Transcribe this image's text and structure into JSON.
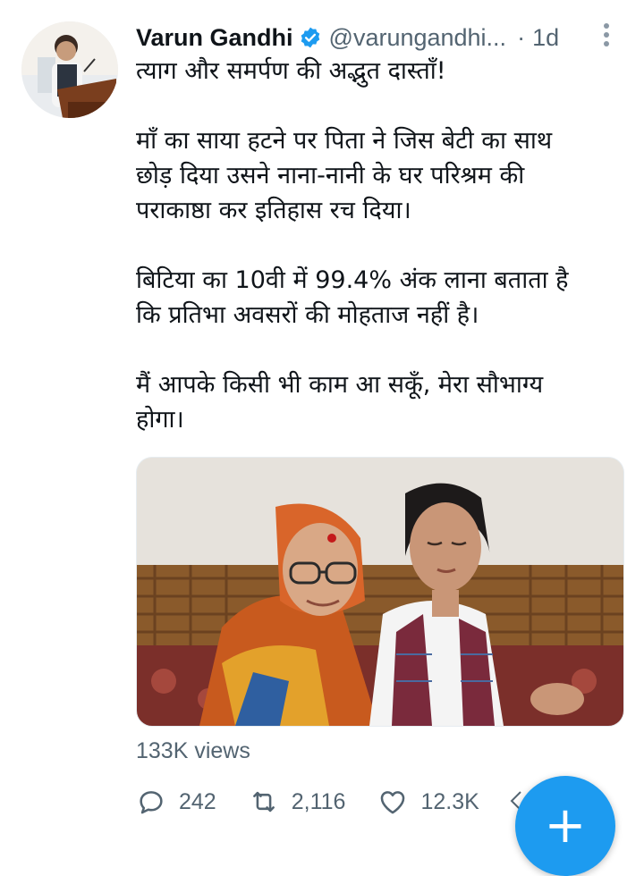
{
  "tweet": {
    "author": {
      "display_name": "Varun Gandhi",
      "handle": "@varungandhi...",
      "verified": true,
      "avatar_icon": "profile-photo-speaker-at-podium"
    },
    "separator": "·",
    "time": "1d",
    "paragraphs": [
      "त्याग और समर्पण की अद्भुत दास्ताँ!",
      "माँ का साया हटने पर पिता ने जिस बेटी का साथ\nछोड़ दिया उसने नाना-नानी के घर परिश्रम की\nपराकाष्ठा कर इतिहास रच दिया।",
      "बिटिया का 10वी में 99.4% अंक लाना बताता है\nकि प्रतिभा अवसरों की मोहताज नहीं है।",
      "मैं आपके किसी भी काम आ सकूँ, मेरा सौभाग्य\nहोगा।"
    ],
    "media_description_icon": "photo-elderly-woman-and-schoolgirl",
    "views": "133K views",
    "actions": {
      "reply_count": "242",
      "retweet_count": "2,116",
      "like_count": "12.3K"
    }
  },
  "compose_button": {
    "label": "+",
    "icon": "plus-icon"
  },
  "colors": {
    "accent": "#1d9bf0",
    "text": "#0f1419",
    "secondary": "#536471"
  }
}
